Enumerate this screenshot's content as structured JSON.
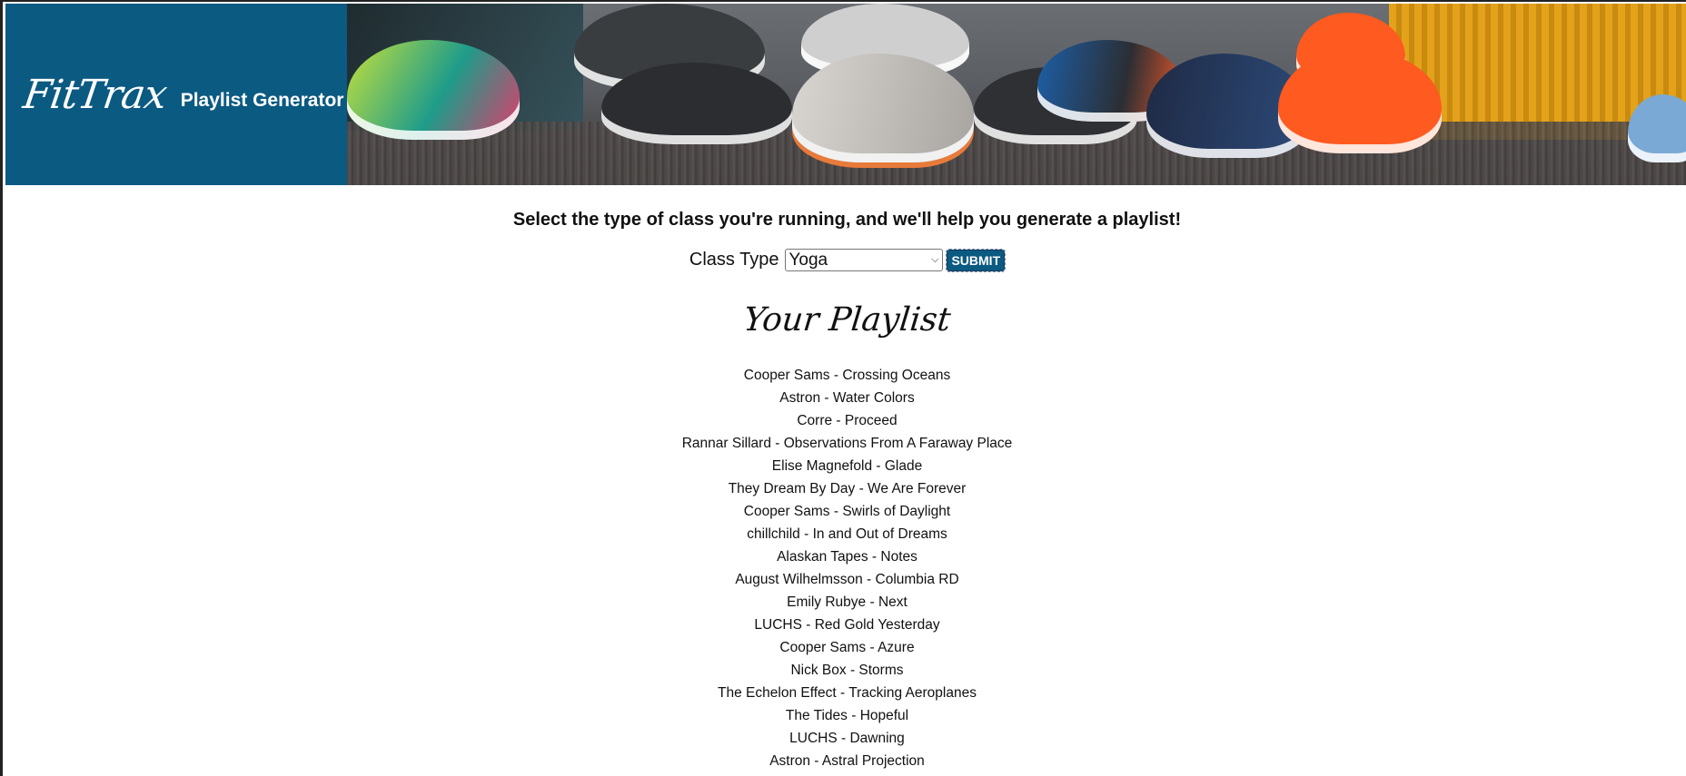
{
  "brand": {
    "logo_text": "FitTrax",
    "subtitle": "Playlist Generator"
  },
  "intro": {
    "tagline": "Select the type of class you're running, and we'll help you generate a playlist!"
  },
  "form": {
    "label": "Class Type",
    "selected": "Yoga",
    "submit_label": "SUBMIT"
  },
  "playlist": {
    "title": "Your Playlist",
    "tracks": [
      "Cooper Sams - Crossing Oceans",
      "Astron - Water Colors",
      "Corre - Proceed",
      "Rannar Sillard - Observations From A Faraway Place",
      "Elise Magnefold - Glade",
      "They Dream By Day - We Are Forever",
      "Cooper Sams - Swirls of Daylight",
      "chillchild - In and Out of Dreams",
      "Alaskan Tapes - Notes",
      "August Wilhelmsson - Columbia RD",
      "Emily Rubye - Next",
      "LUCHS - Red Gold Yesterday",
      "Cooper Sams - Azure",
      "Nick Box - Storms",
      "The Echelon Effect - Tracking Aeroplanes",
      "The Tides - Hopeful",
      "LUCHS - Dawning",
      "Astron - Astral Projection"
    ]
  },
  "colors": {
    "brand_blue": "#0b5a82"
  },
  "icons": {
    "select": "chevron-down-icon"
  }
}
